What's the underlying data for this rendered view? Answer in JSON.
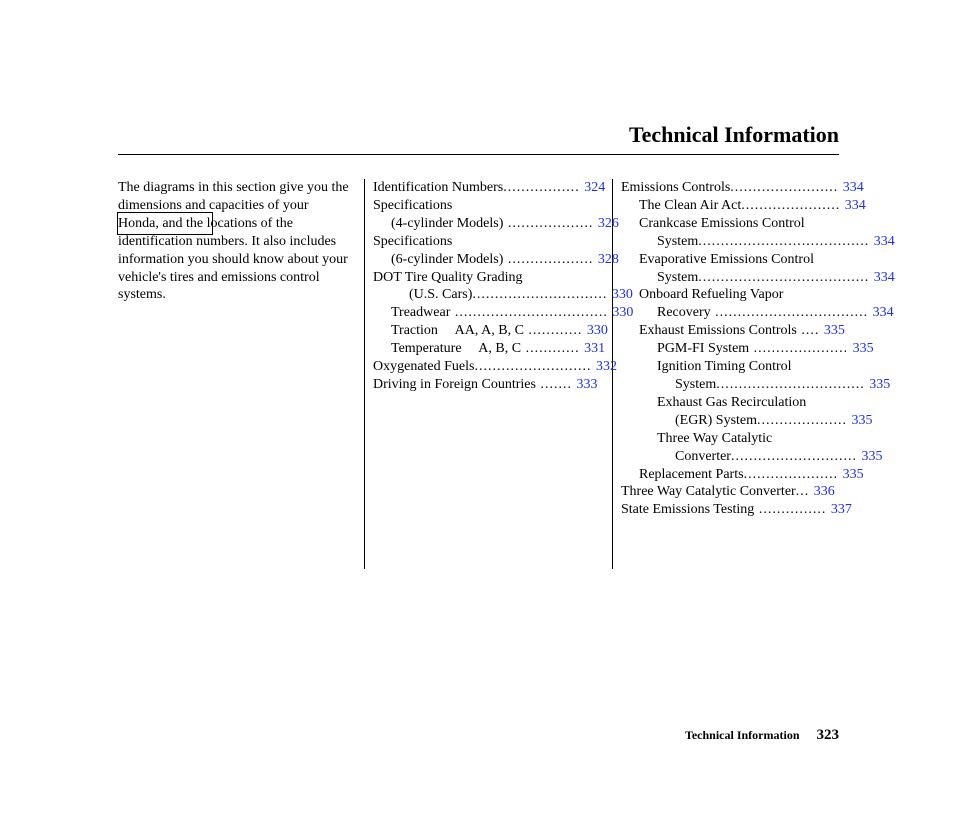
{
  "header": {
    "title": "Technical Information"
  },
  "intro": "The diagrams in this section give you the dimensions and capacities of your Honda, and the locations of the identification numbers. It also includes information you should know about your vehicle's tires and emissions control systems.",
  "col2": [
    {
      "label": "Identification Numbers",
      "dots": ".................",
      "page": "324",
      "indent": 0,
      "seg2": null
    },
    {
      "label": "Specifications",
      "dots": "",
      "page": "",
      "indent": 0,
      "seg2": null
    },
    {
      "label": "(4-cylinder Models)",
      "dots": " ...................",
      "page": "326",
      "indent": 1,
      "seg2": null
    },
    {
      "label": "Specifications",
      "dots": "",
      "page": "",
      "indent": 0,
      "seg2": null
    },
    {
      "label": "(6-cylinder Models)",
      "dots": " ...................",
      "page": "328",
      "indent": 1,
      "seg2": null
    },
    {
      "label": "DOT Tire Quality Grading",
      "dots": "",
      "page": "",
      "indent": 0,
      "seg2": null
    },
    {
      "label": "(U.S. Cars)",
      "dots": "..............................",
      "page": "330",
      "indent": 2,
      "seg2": null
    },
    {
      "label": "Treadwear",
      "dots": " ..................................",
      "page": "330",
      "indent": 1,
      "seg2": null
    },
    {
      "label": "Traction",
      "dots": " ............",
      "page": "330",
      "indent": 1,
      "seg2": "AA, A, B, C"
    },
    {
      "label": "Temperature",
      "dots": " ............",
      "page": "331",
      "indent": 1,
      "seg2": "A, B, C"
    },
    {
      "label": "Oxygenated Fuels",
      "dots": "..........................",
      "page": "332",
      "indent": 0,
      "seg2": null
    },
    {
      "label": "Driving in Foreign Countries",
      "dots": " .......",
      "page": "333",
      "indent": 0,
      "seg2": null
    }
  ],
  "col3": [
    {
      "label": "Emissions Controls",
      "dots": "........................",
      "page": "334",
      "indent": 0
    },
    {
      "label": "The Clean Air Act",
      "dots": "......................",
      "page": "334",
      "indent": 1
    },
    {
      "label": "Crankcase Emissions Control",
      "dots": "",
      "page": "",
      "indent": 1
    },
    {
      "label": "System",
      "dots": "......................................",
      "page": "334",
      "indent": 2
    },
    {
      "label": "Evaporative Emissions Control",
      "dots": "",
      "page": "",
      "indent": 1
    },
    {
      "label": "System",
      "dots": "......................................",
      "page": "334",
      "indent": 2
    },
    {
      "label": "Onboard Refueling Vapor",
      "dots": "",
      "page": "",
      "indent": 1
    },
    {
      "label": "Recovery",
      "dots": " ..................................",
      "page": "334",
      "indent": 2
    },
    {
      "label": "Exhaust Emissions Controls",
      "dots": " ....",
      "page": "335",
      "indent": 1
    },
    {
      "label": "PGM-FI System",
      "dots": " .....................",
      "page": "335",
      "indent": 2
    },
    {
      "label": "Ignition Timing Control",
      "dots": "",
      "page": "",
      "indent": 2
    },
    {
      "label": "System",
      "dots": ".................................",
      "page": "335",
      "indent": 3
    },
    {
      "label": "Exhaust Gas Recirculation",
      "dots": "",
      "page": "",
      "indent": 2
    },
    {
      "label": "(EGR) System",
      "dots": "....................",
      "page": "335",
      "indent": 3
    },
    {
      "label": "Three Way Catalytic",
      "dots": "",
      "page": "",
      "indent": 2
    },
    {
      "label": "Converter",
      "dots": "............................",
      "page": "335",
      "indent": 3
    },
    {
      "label": "Replacement Parts",
      "dots": ".....................",
      "page": "335",
      "indent": 1
    },
    {
      "label": "Three Way Catalytic Converter",
      "dots": "...",
      "page": "336",
      "indent": 0
    },
    {
      "label": "State Emissions Testing",
      "dots": " ...............",
      "page": "337",
      "indent": 0
    }
  ],
  "footer": {
    "title": "Technical Information",
    "page": "323"
  }
}
